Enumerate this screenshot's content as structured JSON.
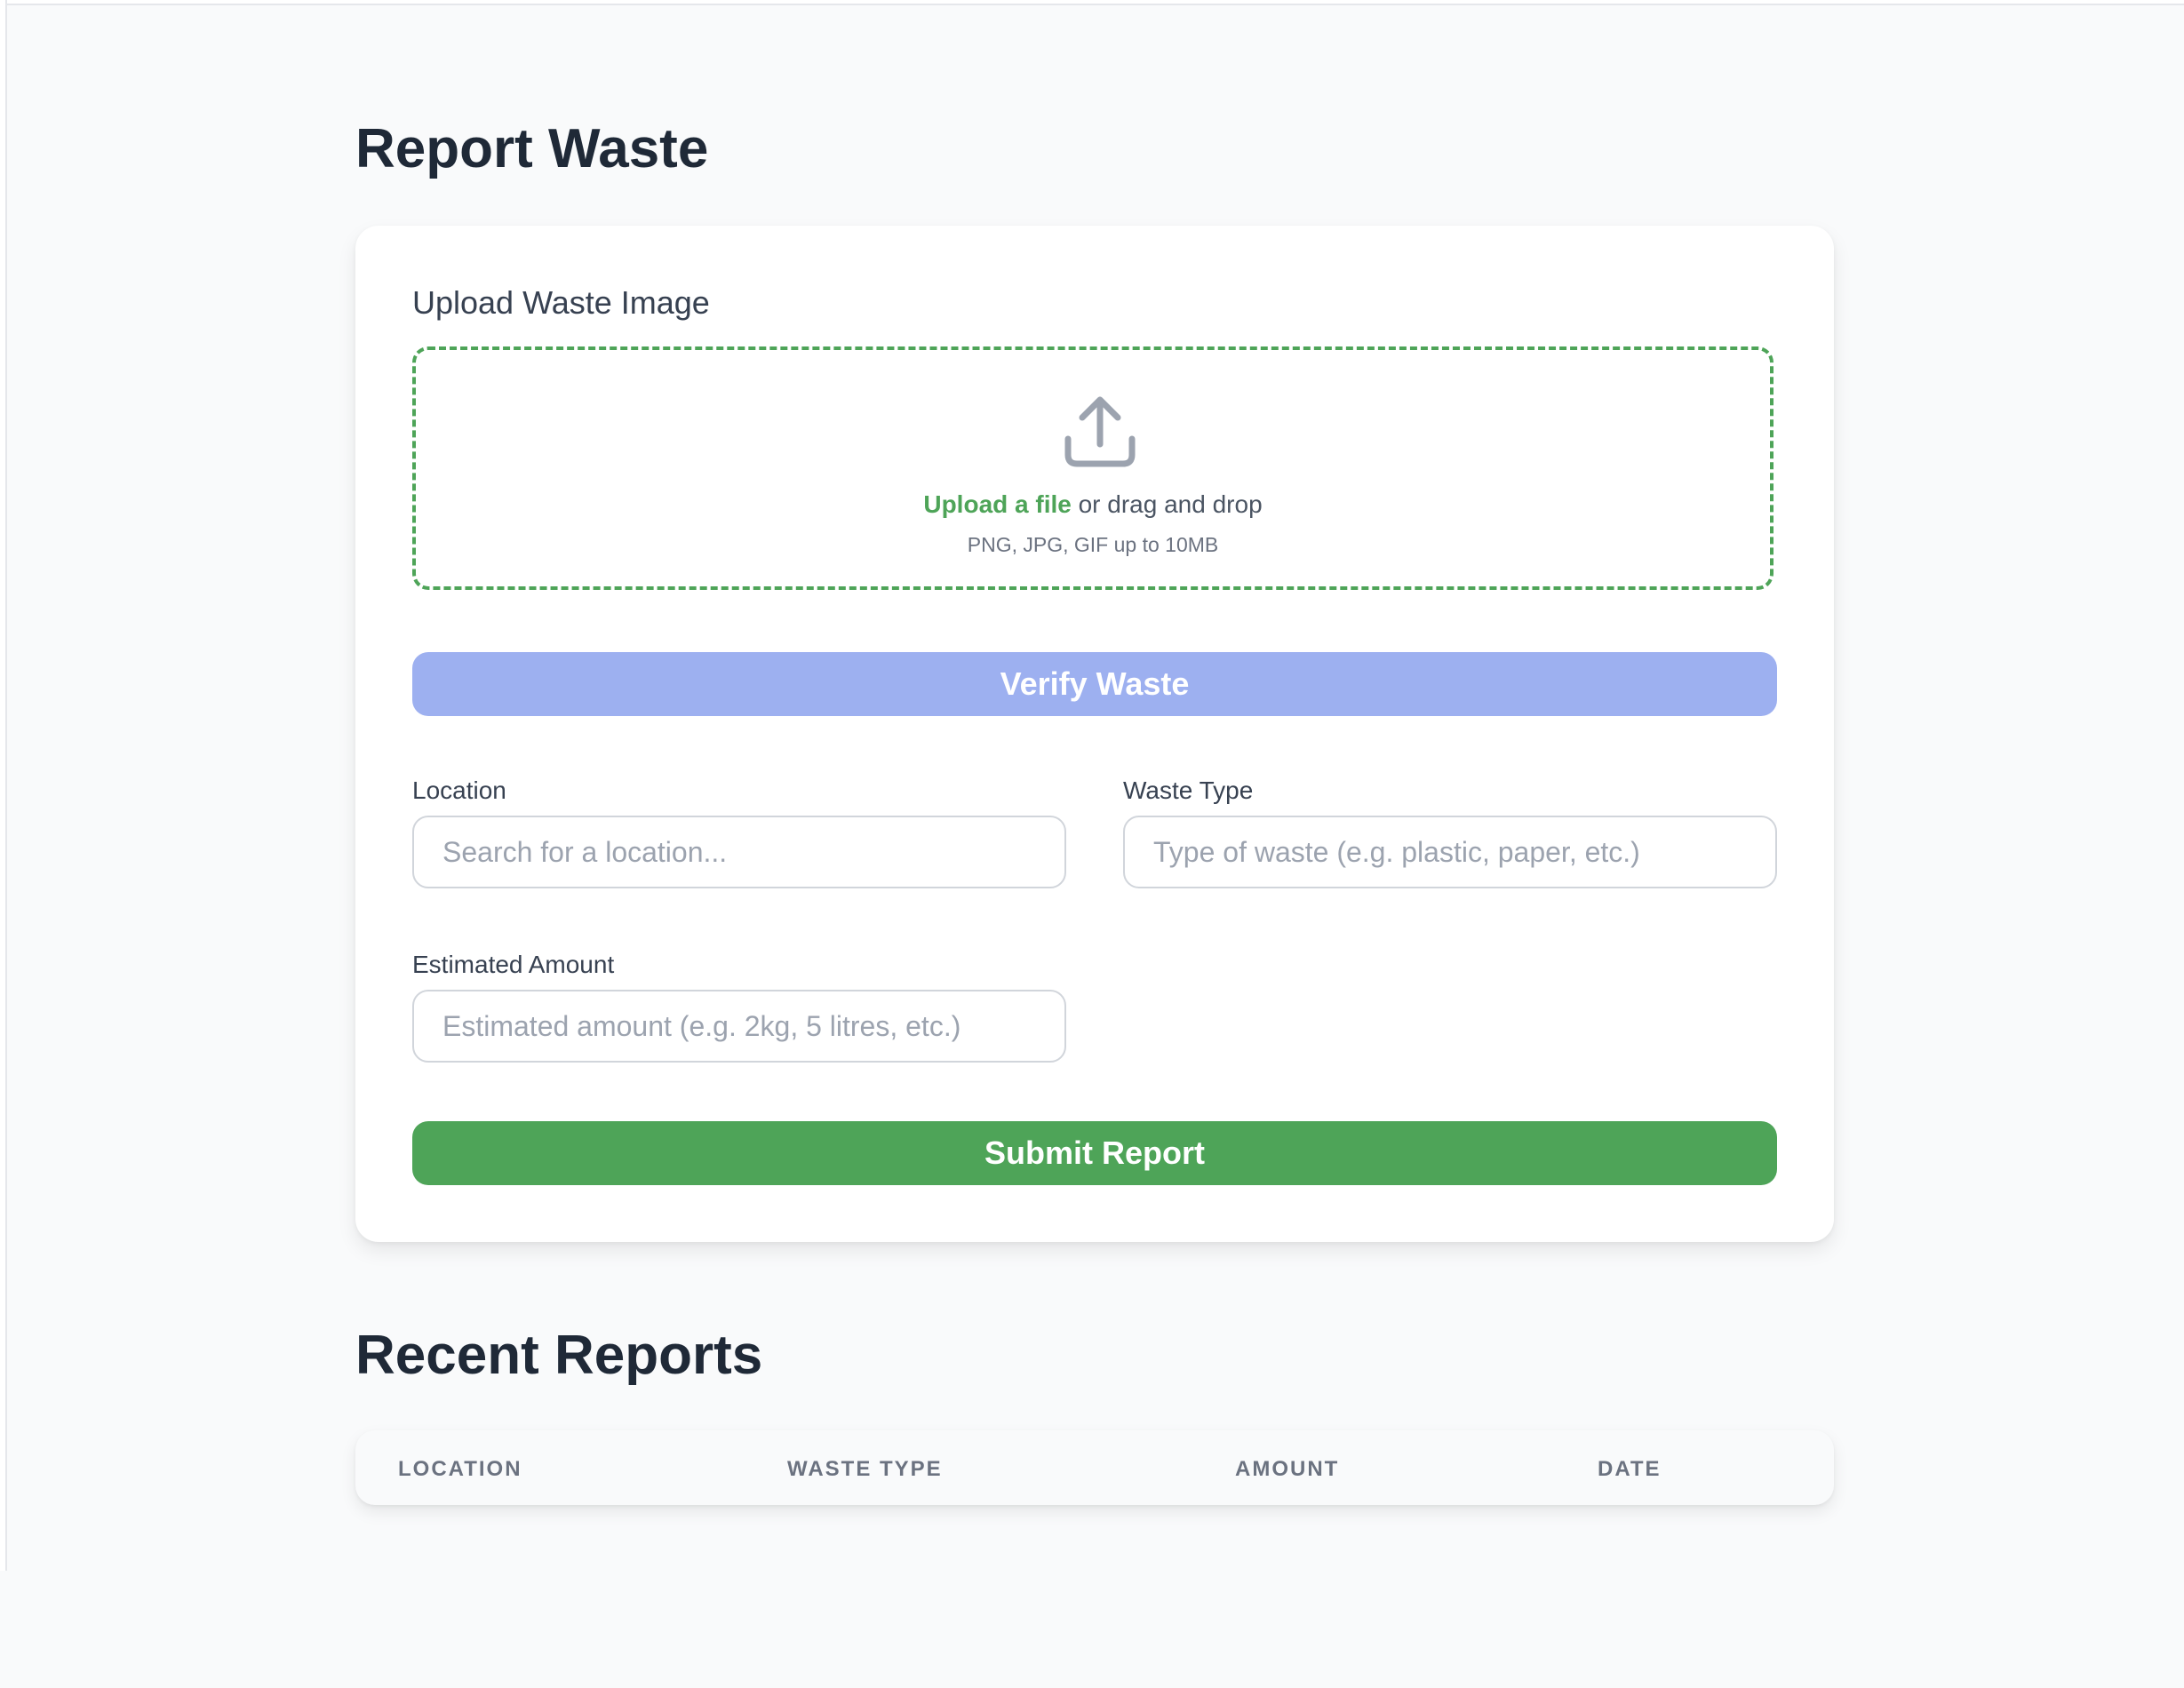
{
  "page": {
    "title": "Report Waste"
  },
  "upload": {
    "label": "Upload Waste Image",
    "icon": "upload-icon",
    "link_text": "Upload a file",
    "rest_text": " or drag and drop",
    "hint": "PNG, JPG, GIF up to 10MB"
  },
  "verify_button": {
    "label": "Verify Waste",
    "color": "#9db0f0"
  },
  "fields": {
    "location": {
      "label": "Location",
      "placeholder": "Search for a location...",
      "value": ""
    },
    "waste_type": {
      "label": "Waste Type",
      "placeholder": "Type of waste (e.g. plastic, paper, etc.)",
      "value": ""
    },
    "amount": {
      "label": "Estimated Amount",
      "placeholder": "Estimated amount (e.g. 2kg, 5 litres, etc.)",
      "value": ""
    }
  },
  "submit_button": {
    "label": "Submit Report",
    "color": "#4ea458"
  },
  "recent": {
    "title": "Recent Reports",
    "columns": [
      "Location",
      "Waste Type",
      "Amount",
      "Date"
    ],
    "rows": []
  },
  "colors": {
    "accent_green": "#4ea458",
    "muted_blue": "#9db0f0",
    "background": "#f9fafb"
  }
}
